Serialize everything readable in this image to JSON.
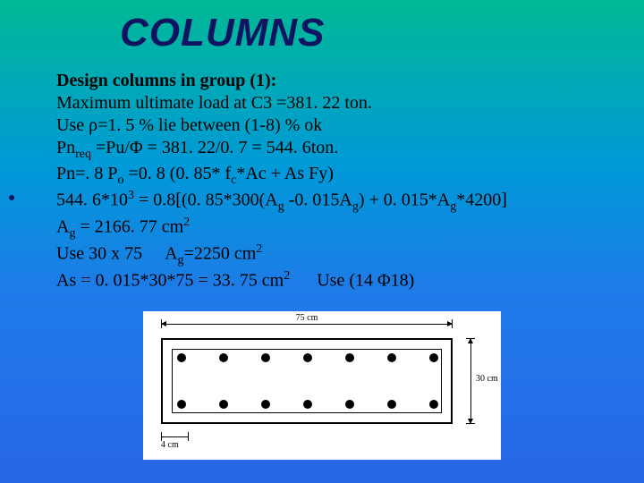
{
  "title": "COLUMNS",
  "lines": {
    "l1": "Design columns in group (1):",
    "l2": "Maximum ultimate load at C3 =381. 22 ton.",
    "l3a": "Use ρ=1. 5 % lie between (1-8) % ok",
    "l4a": "Pn",
    "l4b": "req",
    "l4c": " =Pu/Φ = 381. 22/0. 7 = 544. 6ton.",
    "l5a": "Pn=. 8 P",
    "l5b": "o",
    "l5c": " =0. 8 (0. 85* f",
    "l5d": "c",
    "l5e": "*Ac + As Fy)",
    "l6a": "544. 6*10",
    "l6b": "3",
    "l6c": " = 0.8[(0. 85*300(A",
    "l6d": "g",
    "l6e": " -0. 015A",
    "l6f": "g",
    "l6g": ") + 0. 015*A",
    "l6h": "g",
    "l6i": "*4200]",
    "l7a": " A",
    "l7b": "g",
    "l7c": " = 2166. 77 cm",
    "l7d": "2",
    "l8a": "Use 30 x 75     A",
    "l8b": "g",
    "l8c": "=2250 cm",
    "l8d": "2",
    "l9a": "As = 0. 015*30*75 = 33. 75 cm",
    "l9b": "2",
    "l9c": "      Use (14 Φ18)"
  },
  "diagram": {
    "width_label": "75 cm",
    "height_label": "30 cm",
    "cover_label": "4 cm"
  }
}
